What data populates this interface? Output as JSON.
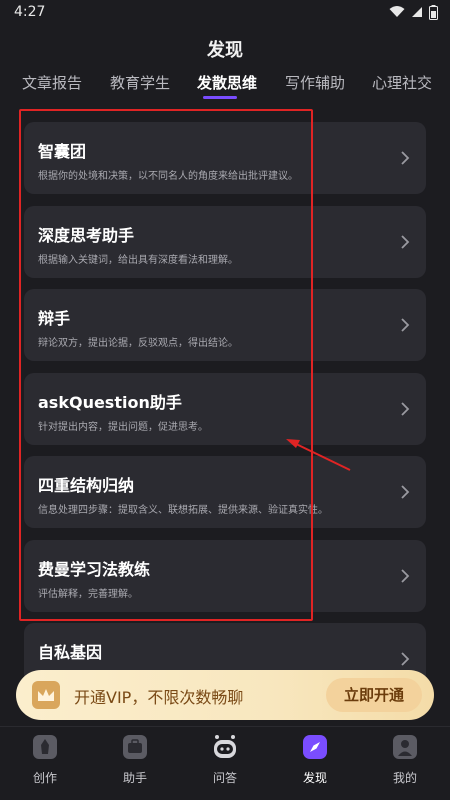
{
  "status_bar": {
    "time": "4:27"
  },
  "header": {
    "title": "发现"
  },
  "tabs": [
    {
      "label": "文章报告",
      "active": false
    },
    {
      "label": "教育学生",
      "active": false
    },
    {
      "label": "发散思维",
      "active": true
    },
    {
      "label": "写作辅助",
      "active": false
    },
    {
      "label": "心理社交",
      "active": false
    }
  ],
  "cards": [
    {
      "title": "智囊团",
      "description": "根据你的处境和决策，以不同名人的角度来给出批评建议。"
    },
    {
      "title": "深度思考助手",
      "description": "根据输入关键词，给出具有深度看法和理解。"
    },
    {
      "title": "辩手",
      "description": "辩论双方，提出论据，反驳观点，得出结论。"
    },
    {
      "title": "askQuestion助手",
      "description": "针对提出内容，提出问题，促进思考。"
    },
    {
      "title": "四重结构归纳",
      "description": "信息处理四步骤：提取含义、联想拓展、提供来源、验证真实性。"
    },
    {
      "title": "费曼学习法教练",
      "description": "评估解释，完善理解。"
    },
    {
      "title": "自私基因",
      "description": ""
    }
  ],
  "vip_banner": {
    "text": "开通VIP，不限次数畅聊",
    "button": "立即开通"
  },
  "bottom_nav": [
    {
      "label": "创作",
      "icon": "create-icon",
      "active": false
    },
    {
      "label": "助手",
      "icon": "briefcase-icon",
      "active": false
    },
    {
      "label": "问答",
      "icon": "robot-icon",
      "active": false
    },
    {
      "label": "发现",
      "icon": "compass-icon",
      "active": true
    },
    {
      "label": "我的",
      "icon": "profile-icon",
      "active": false
    }
  ],
  "colors": {
    "background": "#1c1c20",
    "card": "#2b2b31",
    "accent": "#7a4dff",
    "annotation": "#e02424",
    "vip_gold": "#f3d29c"
  }
}
